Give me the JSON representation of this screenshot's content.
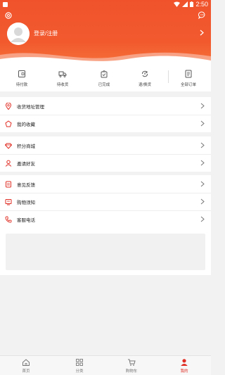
{
  "status_bar": {
    "time": "2:50"
  },
  "header": {
    "login_label": "登录/注册"
  },
  "orders": [
    {
      "label": "待付款",
      "icon": "wallet-icon"
    },
    {
      "label": "待收货",
      "icon": "truck-icon"
    },
    {
      "label": "已完成",
      "icon": "bag-check-icon"
    },
    {
      "label": "退/换货",
      "icon": "refund-icon"
    },
    {
      "label": "全部订单",
      "icon": "list-icon"
    }
  ],
  "menu_group1": [
    {
      "label": "收货地址管理",
      "icon": "location-icon"
    },
    {
      "label": "我的收藏",
      "icon": "pentagon-star-icon"
    }
  ],
  "menu_group2": [
    {
      "label": "积分商城",
      "icon": "diamond-icon"
    },
    {
      "label": "邀请好友",
      "icon": "person-icon"
    }
  ],
  "menu_group3": [
    {
      "label": "意见反馈",
      "icon": "feedback-icon"
    },
    {
      "label": "购物须知",
      "icon": "notice-icon"
    },
    {
      "label": "客服电话",
      "icon": "phone-icon"
    }
  ],
  "tabbar": [
    {
      "label": "首页",
      "icon": "home-icon"
    },
    {
      "label": "分类",
      "icon": "grid-icon"
    },
    {
      "label": "购物车",
      "icon": "cart-icon"
    },
    {
      "label": "我的",
      "icon": "user-icon"
    }
  ],
  "colors": {
    "accent": "#e02e24",
    "header": "#f0532c"
  }
}
